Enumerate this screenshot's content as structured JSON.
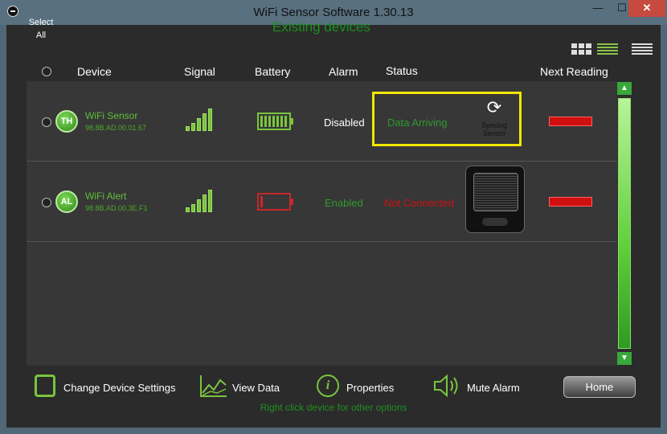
{
  "window": {
    "title": "WiFi Sensor Software 1.30.13",
    "min_glyph": "—",
    "max_glyph": "☐",
    "close_glyph": "✕"
  },
  "header": {
    "select_all": "Select All",
    "section_title": "Existing devices",
    "columns": {
      "device": "Device",
      "signal": "Signal",
      "battery": "Battery",
      "alarm": "Alarm",
      "status": "Status",
      "next_reading": "Next Reading"
    }
  },
  "devices": [
    {
      "badge": "TH",
      "name": "WiFi Sensor",
      "mac": "98.8B.AD.00.01.67",
      "signal_bars": 5,
      "battery_level": 1.0,
      "alarm": "Disabled",
      "status": "Data Arriving",
      "sync_label": "Syncing Sensor"
    },
    {
      "badge": "AL",
      "name": "WiFi Alert",
      "mac": "98.8B.AD.00.3E.F1",
      "signal_bars": 5,
      "battery_level": 0.1,
      "alarm": "Enabled",
      "status": "Not Connected"
    }
  ],
  "toolbar": {
    "change_settings": "Change Device Settings",
    "view_data": "View Data",
    "properties": "Properties",
    "mute_alarm": "Mute Alarm",
    "home": "Home",
    "hint": "Right click device for other options"
  },
  "colors": {
    "accent_green": "#7ac43d",
    "status_green": "#2f9a2f",
    "error_red": "#d01010",
    "highlight_yellow": "#f2e600"
  }
}
